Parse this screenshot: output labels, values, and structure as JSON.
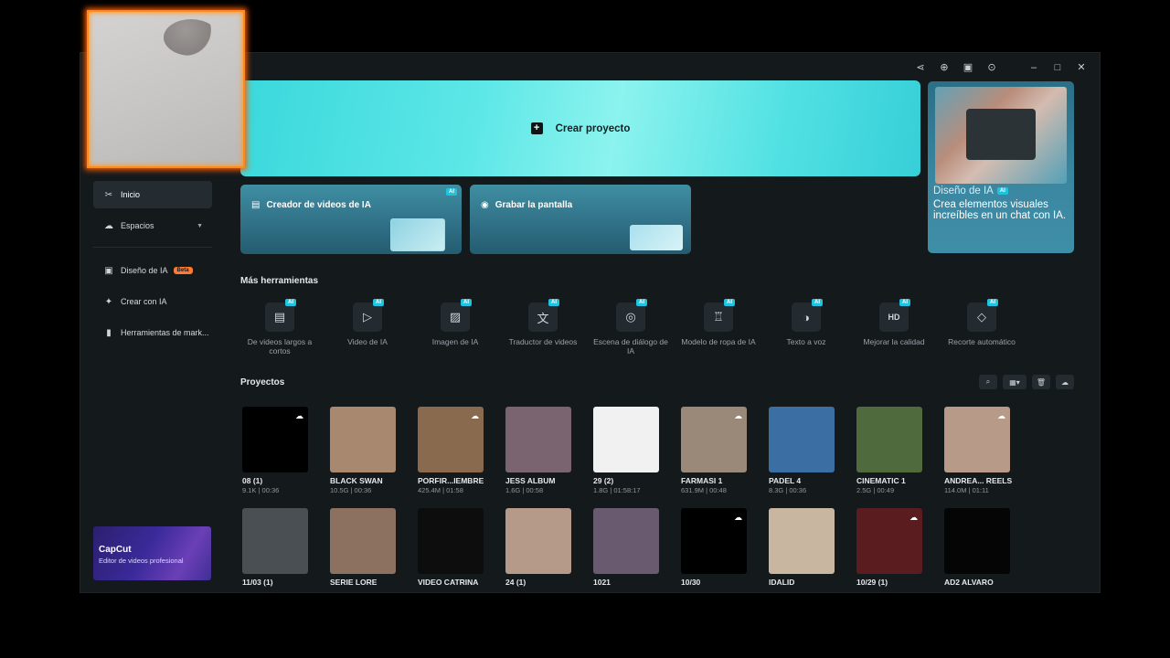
{
  "window": {
    "controls": [
      "share-icon",
      "upload-icon",
      "feedback-icon",
      "settings-icon",
      "minimize-icon",
      "maximize-icon",
      "close-icon"
    ]
  },
  "sidebar": {
    "items": [
      {
        "label": "Inicio",
        "icon": "home-icon",
        "active": true
      },
      {
        "label": "Espacios",
        "icon": "cloud-icon",
        "active": false
      }
    ],
    "items2": [
      {
        "label": "Diseño de IA",
        "icon": "image-icon",
        "badge": "Beta"
      },
      {
        "label": "Crear con IA",
        "icon": "sparkle-icon"
      },
      {
        "label": "Herramientas de mark...",
        "icon": "marketing-icon"
      }
    ],
    "promo": {
      "title": "CapCut",
      "subtitle": "Editor de videos profesional"
    }
  },
  "hero": {
    "label": "Crear proyecto"
  },
  "cards": [
    {
      "label": "Creador de videos de IA",
      "badge": "AI"
    },
    {
      "label": "Grabar la pantalla"
    }
  ],
  "side_card": {
    "title": "Diseño de IA",
    "badge": "AI",
    "description": "Crea elementos visuales increíbles en un chat con IA."
  },
  "tools_section": {
    "title": "Más herramientas",
    "items": [
      {
        "label": "De videos largos a cortos",
        "icon": "film-icon",
        "glyph": "▤"
      },
      {
        "label": "Video de IA",
        "icon": "video-ai-icon",
        "glyph": "▷"
      },
      {
        "label": "Imagen de IA",
        "icon": "image-ai-icon",
        "glyph": "▨"
      },
      {
        "label": "Traductor de videos",
        "icon": "translate-icon",
        "glyph": "文"
      },
      {
        "label": "Escena de diálogo de IA",
        "icon": "dialog-icon",
        "glyph": "◎"
      },
      {
        "label": "Modelo de ropa de IA",
        "icon": "shirt-icon",
        "glyph": "♖"
      },
      {
        "label": "Texto a voz",
        "icon": "voice-icon",
        "glyph": "◑"
      },
      {
        "label": "Mejorar la calidad",
        "icon": "hd-icon",
        "glyph": "HD"
      },
      {
        "label": "Recorte automático",
        "icon": "eraser-icon",
        "glyph": "◇"
      }
    ],
    "badge": "AI"
  },
  "projects": {
    "title": "Proyectos",
    "items": [
      {
        "name": "08 (1)",
        "meta": "9.1K | 00:36",
        "cloud": true,
        "color": "#000000"
      },
      {
        "name": "BLACK SWAN",
        "meta": "10.5G | 00:36",
        "cloud": false,
        "color": "#a8896f"
      },
      {
        "name": "PORFIR...IEMBRE",
        "meta": "425.4M | 01:58",
        "cloud": true,
        "color": "#8a6a4f"
      },
      {
        "name": "JESS ALBUM",
        "meta": "1.6G | 00:58",
        "cloud": false,
        "color": "#7a6470"
      },
      {
        "name": "29 (2)",
        "meta": "1.8G | 01:58:17",
        "cloud": false,
        "color": "#f1f1f1"
      },
      {
        "name": "FARMASI 1",
        "meta": "631.9M | 00:48",
        "cloud": true,
        "color": "#9a8878"
      },
      {
        "name": "PADEL 4",
        "meta": "8.3G | 00:36",
        "cloud": false,
        "color": "#3b6fa3"
      },
      {
        "name": "CINEMATIC 1",
        "meta": "2.5G | 00:49",
        "cloud": false,
        "color": "#4f6a3c"
      },
      {
        "name": "ANDREA... REELS",
        "meta": "114.0M | 01:11",
        "cloud": true,
        "color": "#b89a88"
      },
      {
        "name": "11/03 (1)",
        "meta": "",
        "cloud": false,
        "color": "#4a4f53"
      },
      {
        "name": "SERIE LORE",
        "meta": "",
        "cloud": false,
        "color": "#8c7060"
      },
      {
        "name": "VIDEO CATRINA",
        "meta": "",
        "cloud": false,
        "color": "#0d0d0d"
      },
      {
        "name": "24 (1)",
        "meta": "",
        "cloud": false,
        "color": "#b59a8a"
      },
      {
        "name": "1021",
        "meta": "",
        "cloud": false,
        "color": "#6a5a70"
      },
      {
        "name": "10/30",
        "meta": "",
        "cloud": true,
        "color": "#000000"
      },
      {
        "name": "IDALID",
        "meta": "",
        "cloud": false,
        "color": "#c9b6a0"
      },
      {
        "name": "10/29 (1)",
        "meta": "",
        "cloud": true,
        "color": "#5a1c1f"
      },
      {
        "name": "AD2 ALVARO",
        "meta": "",
        "cloud": false,
        "color": "#050505"
      }
    ]
  }
}
